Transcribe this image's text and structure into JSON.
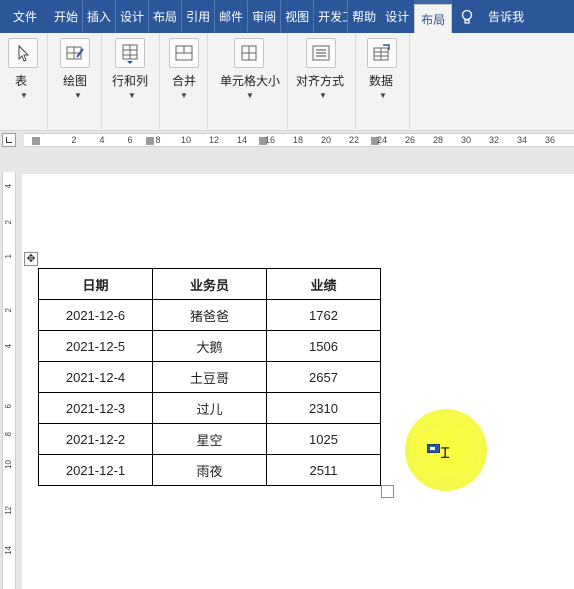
{
  "menubar": {
    "tabs": [
      "文件",
      "开始",
      "插入",
      "设计",
      "布局",
      "引用",
      "邮件",
      "审阅",
      "视图",
      "开发工",
      "帮助"
    ],
    "context_design": "设计",
    "context_layout": "布局",
    "tell_me": "告诉我"
  },
  "ribbon": {
    "groups": [
      "表",
      "绘图",
      "行和列",
      "合并",
      "单元格大小",
      "对齐方式",
      "数据"
    ]
  },
  "ruler": {
    "h_numbers": [
      "2",
      "4",
      "6",
      "8",
      "10",
      "12",
      "14",
      "16",
      "18",
      "20",
      "22",
      "24",
      "26",
      "28",
      "30",
      "32",
      "34",
      "36"
    ],
    "v_numbers": [
      "4",
      "2",
      "1",
      "2",
      "4",
      "6",
      "8",
      "10",
      "12",
      "14"
    ]
  },
  "table": {
    "headers": [
      "日期",
      "业务员",
      "业绩"
    ],
    "rows": [
      [
        "2021-12-6",
        "猪爸爸",
        "1762"
      ],
      [
        "2021-12-5",
        "大鹅",
        "1506"
      ],
      [
        "2021-12-4",
        "土豆哥",
        "2657"
      ],
      [
        "2021-12-3",
        "过儿",
        "2310"
      ],
      [
        "2021-12-2",
        "星空",
        "1025"
      ],
      [
        "2021-12-1",
        "雨夜",
        "2511"
      ]
    ]
  },
  "colors": {
    "accent": "#2b579a",
    "highlight": "#f9fc3f"
  }
}
